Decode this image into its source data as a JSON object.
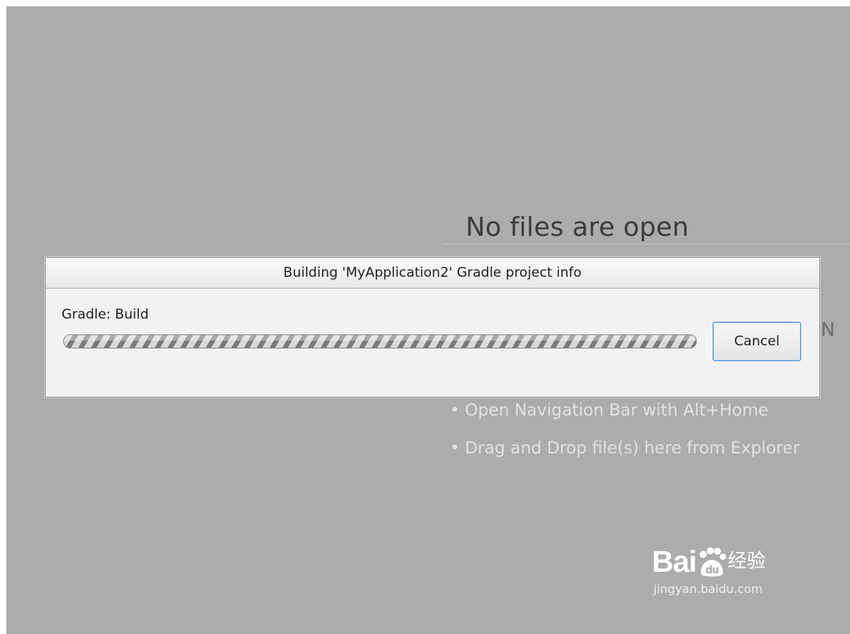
{
  "editor": {
    "empty_title": "No files are open",
    "hints": [
      "• Open Navigation Bar with Alt+Home",
      "• Drag and Drop file(s) here from Explorer"
    ],
    "edge_glyph": "N"
  },
  "dialog": {
    "title": "Building 'MyApplication2' Gradle project info",
    "task_label": "Gradle: Build",
    "progress": "indeterminate",
    "cancel_label": "Cancel"
  },
  "watermark": {
    "logo_text_left": "Bai",
    "logo_text_right": "经验",
    "url": "jingyan.baidu.com"
  },
  "colors": {
    "background": "#acacac",
    "dialog_bg": "#f2f2f2",
    "button_focus_border": "#4a8ad8"
  }
}
